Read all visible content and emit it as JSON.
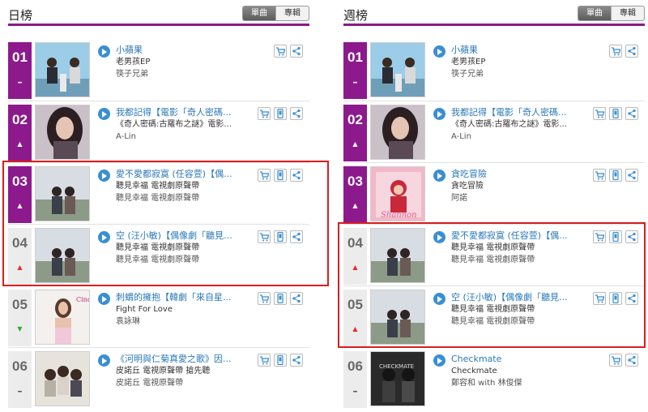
{
  "left": {
    "title": "日榜",
    "toggle": [
      "單曲",
      "專輯"
    ],
    "rows": [
      {
        "rank": "01",
        "trend": "–",
        "title": "小蘋果",
        "line2": "老男孩EP",
        "line3": "筷子兄弟"
      },
      {
        "rank": "02",
        "trend": "▲",
        "title": "我都記得【電影「奇人密碼...",
        "line2": "《奇人密碼:古羅布之謎》電影...",
        "line3": "A-Lin"
      },
      {
        "rank": "03",
        "trend": "▲",
        "title": "愛不愛都寂寞 (任容萱)【偶...",
        "line2": "聽見幸福 電視劇原聲帶",
        "line3": "聽見幸福 電視劇原聲帶"
      },
      {
        "rank": "04",
        "trend": "▲",
        "title": "空 (汪小敏)【偶像劇「聽見...",
        "line2": "聽見幸福 電視劇原聲帶",
        "line3": "聽見幸福 電視劇原聲帶"
      },
      {
        "rank": "05",
        "trend": "▼",
        "title": "刺蝟的擁抱【韓劇「來自星...",
        "line2": "Fight For Love",
        "line3": "袁詠琳"
      },
      {
        "rank": "06",
        "trend": "–",
        "title": "《河明與仁菊真愛之歌》因...",
        "line2": "皮諾丘 電視原聲帶 搶先聽",
        "line3": "皮諾丘 電視原聲帶"
      }
    ]
  },
  "right": {
    "title": "週榜",
    "toggle": [
      "單曲",
      "專輯"
    ],
    "rows": [
      {
        "rank": "01",
        "trend": "–",
        "title": "小蘋果",
        "line2": "老男孩EP",
        "line3": "筷子兄弟"
      },
      {
        "rank": "02",
        "trend": "▲",
        "title": "我都記得【電影「奇人密碼...",
        "line2": "《奇人密碼:古羅布之謎》電影...",
        "line3": "A-Lin"
      },
      {
        "rank": "03",
        "trend": "▲",
        "title": "貪吃冒險",
        "line2": "貪吃冒險",
        "line3": "阿諾"
      },
      {
        "rank": "04",
        "trend": "▲",
        "title": "愛不愛都寂寞 (任容萱)【偶...",
        "line2": "聽見幸福 電視劇原聲帶",
        "line3": "聽見幸福 電視劇原聲帶"
      },
      {
        "rank": "05",
        "trend": "▲",
        "title": "空 (汪小敏)【偶像劇「聽見...",
        "line2": "聽見幸福 電視劇原聲帶",
        "line3": "聽見幸福 電視劇原聲帶"
      },
      {
        "rank": "06",
        "trend": "–",
        "title": "Checkmate",
        "line2": "Checkmate",
        "line3": "鄭容和 with 林俊傑"
      }
    ]
  },
  "icons": {
    "play": "play-icon",
    "cart": "cart-icon",
    "phone": "phone-icon",
    "share": "share-icon"
  },
  "colors": {
    "accent": "#8c1a8c",
    "link": "#2a78b8",
    "highlight": "#d81e1e",
    "up": "#e03030",
    "down": "#3aa835"
  }
}
